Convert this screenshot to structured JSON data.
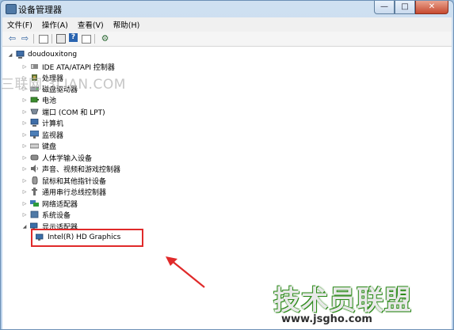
{
  "window": {
    "title": "设备管理器",
    "controls": {
      "minimize": "—",
      "maximize": "□",
      "close": "✕"
    }
  },
  "menu": [
    "文件(F)",
    "操作(A)",
    "查看(V)",
    "帮助(H)"
  ],
  "toolbar": {
    "buttons": [
      "back-arrow-icon",
      "forward-arrow-icon",
      "list-view-icon",
      "properties-icon",
      "help-icon",
      "grid-view-icon",
      "scan-hardware-icon"
    ]
  },
  "tree": {
    "root": "doudouxitong",
    "categories": [
      "IDE ATA/ATAPI 控制器",
      "处理器",
      "磁盘驱动器",
      "电池",
      "端口 (COM 和 LPT)",
      "计算机",
      "监视器",
      "键盘",
      "人体学输入设备",
      "声音、视频和游戏控制器",
      "鼠标和其他指针设备",
      "通用串行总线控制器",
      "网络适配器",
      "系统设备",
      "显示适配器"
    ],
    "display_child": "Intel(R) HD Graphics",
    "expander_collapsed": "▷",
    "expander_expanded": "◢"
  },
  "overlay": {
    "watermark": "三联网 3LIAN.COM",
    "brand": "技术员联盟",
    "brand_url": "www.jsgho.com"
  },
  "colors": {
    "highlight": "#e02a2a",
    "title_bar": "#cfe0f1",
    "brand_green": "#2d8a1b"
  }
}
